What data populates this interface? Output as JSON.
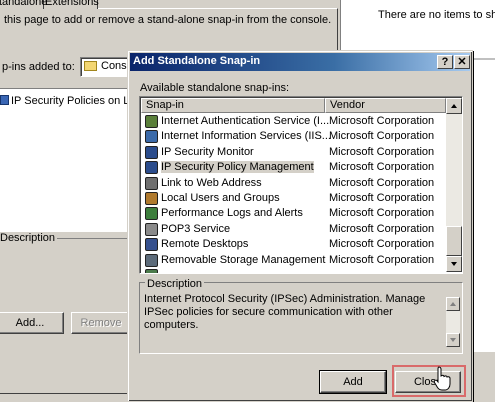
{
  "background_dialog": {
    "tabs": [
      {
        "label": "tandalone"
      },
      {
        "label": "Extensions"
      }
    ],
    "instruction": "this page to add or remove a stand-alone snap-in from the console.",
    "added_to_label": "p-ins added to:",
    "added_to_value": "Conso",
    "snapins": [
      {
        "label": "IP Security Policies on Loca"
      }
    ],
    "description_label": "Description",
    "add_label": "Add...",
    "remove_label": "Remove"
  },
  "right_window": {
    "empty_text": "There are no items to show"
  },
  "dialog": {
    "title": "Add Standalone Snap-in",
    "help_label": "?",
    "close_x_label": "✕",
    "available_label": "Available standalone snap-ins:",
    "columns": {
      "snapin": "Snap-in",
      "vendor": "Vendor"
    },
    "rows": [
      {
        "name": "Internet Authentication Service (I...",
        "vendor": "Microsoft Corporation",
        "icon": "ias-icon",
        "color": "#5a7f3a"
      },
      {
        "name": "Internet Information Services (IIS...",
        "vendor": "Microsoft Corporation",
        "icon": "iis-icon",
        "color": "#3b6aa9"
      },
      {
        "name": "IP Security Monitor",
        "vendor": "Microsoft Corporation",
        "icon": "ipsec-monitor-icon",
        "color": "#2b4c8c"
      },
      {
        "name": "IP Security Policy Management",
        "vendor": "Microsoft Corporation",
        "icon": "ipsec-policy-icon",
        "color": "#2b4c8c"
      },
      {
        "name": "Link to Web Address",
        "vendor": "Microsoft Corporation",
        "icon": "link-icon",
        "color": "#6f6f6f"
      },
      {
        "name": "Local Users and Groups",
        "vendor": "Microsoft Corporation",
        "icon": "users-icon",
        "color": "#b07a2e"
      },
      {
        "name": "Performance Logs and Alerts",
        "vendor": "Microsoft Corporation",
        "icon": "performance-icon",
        "color": "#3c7e3c"
      },
      {
        "name": "POP3 Service",
        "vendor": "Microsoft Corporation",
        "icon": "pop3-icon",
        "color": "#8a8a8a"
      },
      {
        "name": "Remote Desktops",
        "vendor": "Microsoft Corporation",
        "icon": "remote-desktop-icon",
        "color": "#35508e"
      },
      {
        "name": "Removable Storage Management",
        "vendor": "Microsoft Corporation",
        "icon": "storage-icon",
        "color": "#5c6b7a"
      },
      {
        "name": "",
        "vendor": "",
        "icon": "partial-row-icon",
        "color": "#4a7a4a"
      }
    ],
    "selected_index": 3,
    "description_label": "Description",
    "description_text": "Internet Protocol Security (IPSec) Administration. Manage IPSec policies for secure communication with other computers.",
    "add_label": "Add",
    "close_label": "Close"
  },
  "colors": {
    "title_gradient_start": "#0a246a",
    "title_gradient_end": "#a6caf0",
    "highlight_box": "#d96a6a",
    "window_face": "#d4d0c8"
  }
}
